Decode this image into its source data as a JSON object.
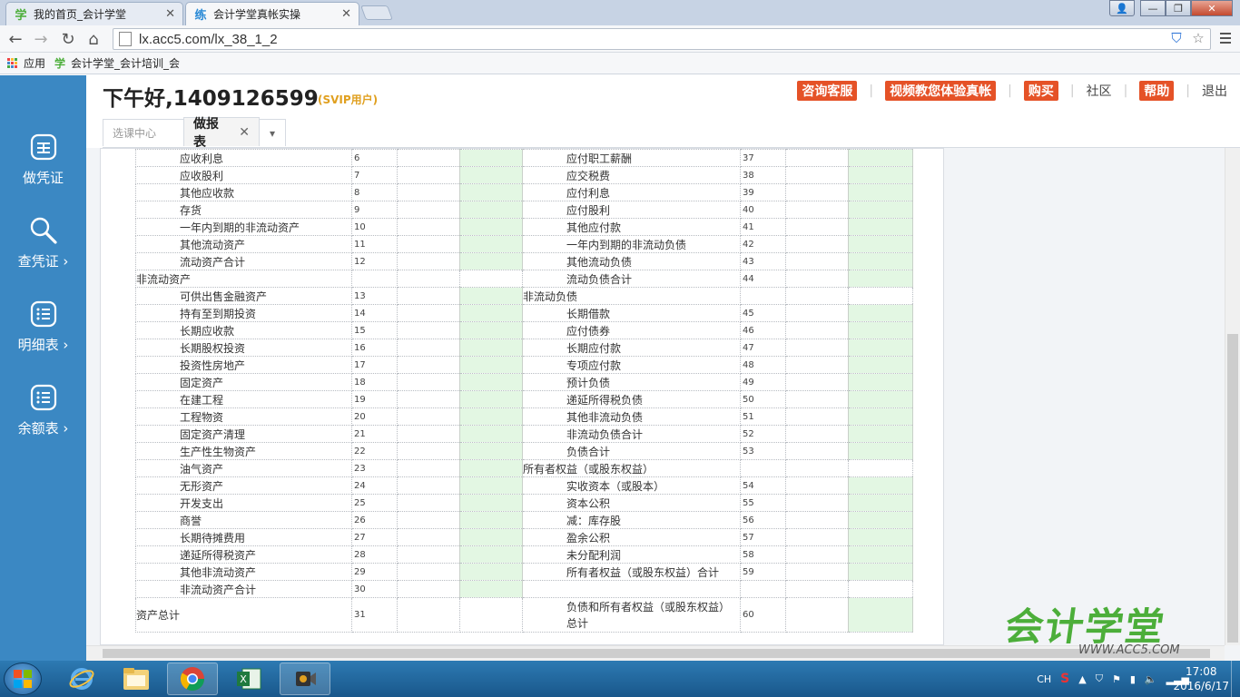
{
  "browser": {
    "tabs": [
      {
        "label": "我的首页_会计学堂",
        "favicon": "学"
      },
      {
        "label": "会计学堂真帐实操",
        "favicon": "练"
      }
    ],
    "url": "lx.acc5.com/lx_38_1_2",
    "bookmarks": [
      {
        "label": "应用"
      },
      {
        "label": "会计学堂_会计培训_会",
        "favicon": "学"
      }
    ]
  },
  "header": {
    "greeting": "下午好,1409126599",
    "vip": "(SVIP用户)",
    "links": {
      "consult": "咨询客服",
      "video": "视频教您体验真帐",
      "buy": "购买",
      "community": "社区",
      "help": "帮助",
      "logout": "退出"
    }
  },
  "page_tabs": [
    {
      "label": "选课中心"
    },
    {
      "label": "做报表"
    }
  ],
  "sidebar": [
    {
      "label": "做凭证",
      "icon": "voucher-icon"
    },
    {
      "label": "查凭证",
      "icon": "search-icon"
    },
    {
      "label": "明细表",
      "icon": "list-icon"
    },
    {
      "label": "余额表",
      "icon": "list-icon"
    }
  ],
  "balance_sheet": {
    "rows": [
      {
        "left": "应收利息",
        "lnum": "6",
        "right": "应付职工薪酬",
        "rnum": "37"
      },
      {
        "left": "应收股利",
        "lnum": "7",
        "right": "应交税费",
        "rnum": "38"
      },
      {
        "left": "其他应收款",
        "lnum": "8",
        "right": "应付利息",
        "rnum": "39"
      },
      {
        "left": "存货",
        "lnum": "9",
        "right": "应付股利",
        "rnum": "40"
      },
      {
        "left": "一年内到期的非流动资产",
        "lnum": "10",
        "right": "其他应付款",
        "rnum": "41"
      },
      {
        "left": "其他流动资产",
        "lnum": "11",
        "right": "一年内到期的非流动负债",
        "rnum": "42"
      },
      {
        "left": "流动资产合计",
        "lnum": "12",
        "right": "其他流动负债",
        "rnum": "43"
      },
      {
        "left": "非流动资产",
        "lnum": "",
        "right": "流动负债合计",
        "rnum": "44",
        "left_section": true
      },
      {
        "left": "可供出售金融资产",
        "lnum": "13",
        "right": "非流动负债",
        "rnum": "",
        "right_section": true
      },
      {
        "left": "持有至到期投资",
        "lnum": "14",
        "right": "长期借款",
        "rnum": "45"
      },
      {
        "left": "长期应收款",
        "lnum": "15",
        "right": "应付债券",
        "rnum": "46"
      },
      {
        "left": "长期股权投资",
        "lnum": "16",
        "right": "长期应付款",
        "rnum": "47"
      },
      {
        "left": "投资性房地产",
        "lnum": "17",
        "right": "专项应付款",
        "rnum": "48"
      },
      {
        "left": "固定资产",
        "lnum": "18",
        "right": "预计负债",
        "rnum": "49"
      },
      {
        "left": "在建工程",
        "lnum": "19",
        "right": "递延所得税负债",
        "rnum": "50"
      },
      {
        "left": "工程物资",
        "lnum": "20",
        "right": "其他非流动负债",
        "rnum": "51"
      },
      {
        "left": "固定资产清理",
        "lnum": "21",
        "right": "非流动负债合计",
        "rnum": "52"
      },
      {
        "left": "生产性生物资产",
        "lnum": "22",
        "right": "负债合计",
        "rnum": "53"
      },
      {
        "left": "油气资产",
        "lnum": "23",
        "right": "所有者权益（或股东权益）",
        "rnum": "",
        "right_section": true
      },
      {
        "left": "无形资产",
        "lnum": "24",
        "right": "实收资本（或股本）",
        "rnum": "54"
      },
      {
        "left": "开发支出",
        "lnum": "25",
        "right": "资本公积",
        "rnum": "55"
      },
      {
        "left": "商誉",
        "lnum": "26",
        "right": "减：库存股",
        "rnum": "56"
      },
      {
        "left": "长期待摊费用",
        "lnum": "27",
        "right": "盈余公积",
        "rnum": "57"
      },
      {
        "left": "递延所得税资产",
        "lnum": "28",
        "right": "未分配利润",
        "rnum": "58"
      },
      {
        "left": "其他非流动资产",
        "lnum": "29",
        "right": "所有者权益（或股东权益）合计",
        "rnum": "59"
      },
      {
        "left": "非流动资产合计",
        "lnum": "30",
        "right": "",
        "rnum": "",
        "right_blank": true
      },
      {
        "left": "资产总计",
        "lnum": "31",
        "right": "负债和所有者权益（或股东权益）总计",
        "rnum": "60",
        "left_section": true,
        "tall": true
      }
    ]
  },
  "watermark": {
    "logo_text": "会计学堂",
    "site": "WWW.ACC5.COM"
  },
  "taskbar": {
    "apps": [
      "ie-icon",
      "explorer-icon",
      "chrome-icon",
      "excel-icon",
      "recorder-icon"
    ],
    "tray_lang": "CH",
    "time": "17:08",
    "date": "2016/6/17"
  },
  "colors": {
    "sidebar_bg": "#3b88c3",
    "accent_red": "#e55227",
    "input_green": "#e3f7e3",
    "logo_green": "#4cae3a"
  }
}
